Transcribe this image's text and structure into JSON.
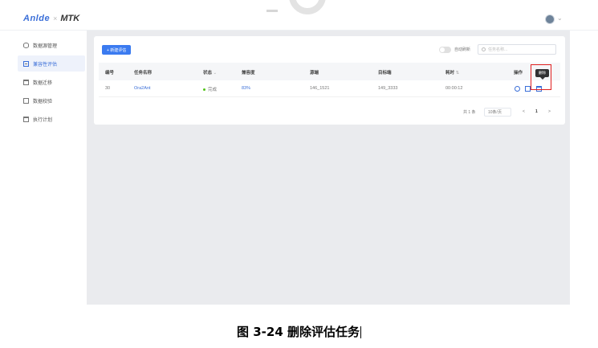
{
  "header": {
    "brand": "Anlde",
    "product": "MTK"
  },
  "sidebar": {
    "items": [
      {
        "label": "数据源管理",
        "icon": "database-icon"
      },
      {
        "label": "兼容性评估",
        "icon": "document-icon",
        "active": true
      },
      {
        "label": "数据迁移",
        "icon": "folder-icon"
      },
      {
        "label": "数据校验",
        "icon": "check-icon"
      },
      {
        "label": "执行计划",
        "icon": "calendar-icon"
      }
    ]
  },
  "toolbar": {
    "add_label": "+ 新建评估",
    "auto_refresh_label": "自动刷新",
    "search_placeholder": "任务名称..."
  },
  "table": {
    "columns": [
      "编号",
      "任务名称",
      "状态",
      "兼容度",
      "源端",
      "目标端",
      "耗时",
      "操作"
    ],
    "rows": [
      {
        "id": "30",
        "name": "Ora2Ant",
        "status": "完成",
        "compat": "83%",
        "source": "146_1521",
        "target": "149_3333",
        "duration": "00:00:12"
      }
    ],
    "tooltip": "删除"
  },
  "pagination": {
    "total": "共 1 条",
    "page_size": "10条/页",
    "prev": "<",
    "current": "1",
    "next": ">"
  },
  "caption": "图 3-24  删除评估任务"
}
